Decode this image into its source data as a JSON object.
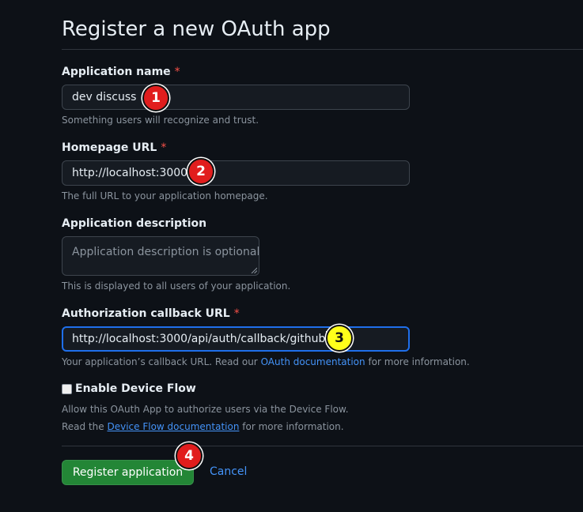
{
  "page": {
    "title": "Register a new OAuth app"
  },
  "fields": {
    "app_name": {
      "label": "Application name",
      "required_mark": "*",
      "value": "dev discuss",
      "hint": "Something users will recognize and trust."
    },
    "homepage_url": {
      "label": "Homepage URL",
      "required_mark": "*",
      "value": "http://localhost:3000",
      "hint": "The full URL to your application homepage."
    },
    "description": {
      "label": "Application description",
      "placeholder": "Application description is optional",
      "hint": "This is displayed to all users of your application."
    },
    "callback_url": {
      "label": "Authorization callback URL",
      "required_mark": "*",
      "value": "http://localhost:3000/api/auth/callback/github",
      "hint_before": "Your application’s callback URL. Read our ",
      "hint_link": "OAuth documentation",
      "hint_after": " for more information."
    }
  },
  "device_flow": {
    "label": "Enable Device Flow",
    "checked": false,
    "hint_line1": "Allow this OAuth App to authorize users via the Device Flow.",
    "hint_line2_before": "Read the ",
    "hint_line2_link": "Device Flow documentation",
    "hint_line2_after": " for more information."
  },
  "actions": {
    "register_label": "Register application",
    "cancel_label": "Cancel"
  },
  "annotations": [
    {
      "number": "1",
      "color": "#e11d1d"
    },
    {
      "number": "2",
      "color": "#e11d1d"
    },
    {
      "number": "3",
      "color": "#ffff1a"
    },
    {
      "number": "4",
      "color": "#e11d1d"
    }
  ],
  "colors": {
    "background": "#0d1117",
    "primary_button": "#238636",
    "link": "#4493f8",
    "required": "#f85149",
    "focus_border": "#1f6feb"
  }
}
